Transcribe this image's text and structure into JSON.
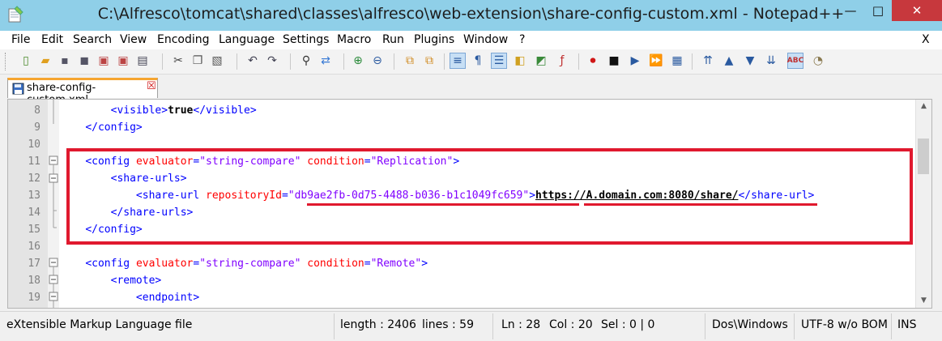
{
  "window": {
    "title": "C:\\Alfresco\\tomcat\\shared\\classes\\alfresco\\web-extension\\share-config-custom.xml - Notepad++",
    "min_label": "—",
    "max_label": "□",
    "close_label": "✕"
  },
  "menu": {
    "items": [
      "File",
      "Edit",
      "Search",
      "View",
      "Encoding",
      "Language",
      "Settings",
      "Macro",
      "Run",
      "Plugins",
      "Window",
      "?"
    ],
    "close_label": "X"
  },
  "tab": {
    "label": "share-config-custom.xml",
    "close_label": "☒"
  },
  "editor": {
    "lines": [
      {
        "num": "8",
        "indent": "        ",
        "tokens": [
          [
            "tag",
            "<visible>"
          ],
          [
            "txt",
            "true"
          ],
          [
            "tag",
            "</visible>"
          ]
        ]
      },
      {
        "num": "9",
        "indent": "    ",
        "tokens": [
          [
            "tag",
            "</config>"
          ]
        ]
      },
      {
        "num": "10",
        "indent": "",
        "tokens": []
      },
      {
        "num": "11",
        "indent": "    ",
        "tokens": [
          [
            "tag",
            "<config "
          ],
          [
            "attr",
            "evaluator"
          ],
          [
            "tag",
            "="
          ],
          [
            "val",
            "\"string-compare\""
          ],
          [
            "tag",
            " "
          ],
          [
            "attr",
            "condition"
          ],
          [
            "tag",
            "="
          ],
          [
            "val",
            "\"Replication\""
          ],
          [
            "tag",
            ">"
          ]
        ]
      },
      {
        "num": "12",
        "indent": "        ",
        "tokens": [
          [
            "tag",
            "<share-urls>"
          ]
        ]
      },
      {
        "num": "13",
        "indent": "            ",
        "tokens": [
          [
            "tag",
            "<share-url "
          ],
          [
            "attr",
            "repositoryId"
          ],
          [
            "tag",
            "="
          ],
          [
            "val",
            "\"db9ae2fb-0d75-4488-b036-b1c1049fc659\""
          ],
          [
            "tag",
            ">"
          ],
          [
            "link",
            "https://A.domain.com:8080/share/"
          ],
          [
            "tag",
            "</share-url>"
          ]
        ]
      },
      {
        "num": "14",
        "indent": "        ",
        "tokens": [
          [
            "tag",
            "</share-urls>"
          ]
        ]
      },
      {
        "num": "15",
        "indent": "    ",
        "tokens": [
          [
            "tag",
            "</config>"
          ]
        ]
      },
      {
        "num": "16",
        "indent": "",
        "tokens": []
      },
      {
        "num": "17",
        "indent": "    ",
        "tokens": [
          [
            "tag",
            "<config "
          ],
          [
            "attr",
            "evaluator"
          ],
          [
            "tag",
            "="
          ],
          [
            "val",
            "\"string-compare\""
          ],
          [
            "tag",
            " "
          ],
          [
            "attr",
            "condition"
          ],
          [
            "tag",
            "="
          ],
          [
            "val",
            "\"Remote\""
          ],
          [
            "tag",
            ">"
          ]
        ]
      },
      {
        "num": "18",
        "indent": "        ",
        "tokens": [
          [
            "tag",
            "<remote>"
          ]
        ]
      },
      {
        "num": "19",
        "indent": "            ",
        "tokens": [
          [
            "tag",
            "<endpoint>"
          ]
        ]
      }
    ]
  },
  "status": {
    "file_type": "eXtensible Markup Language file",
    "length": "length : 2406",
    "lines": "lines : 59",
    "ln": "Ln : 28",
    "col": "Col : 20",
    "sel": "Sel : 0 | 0",
    "eol": "Dos\\Windows",
    "encoding": "UTF-8 w/o BOM",
    "ins": "INS"
  },
  "colors": {
    "titlebar": "#8fcfe8",
    "highlight": "#e0192e",
    "tag": "#0000ff",
    "attr": "#ff0000",
    "value": "#8000ff"
  }
}
